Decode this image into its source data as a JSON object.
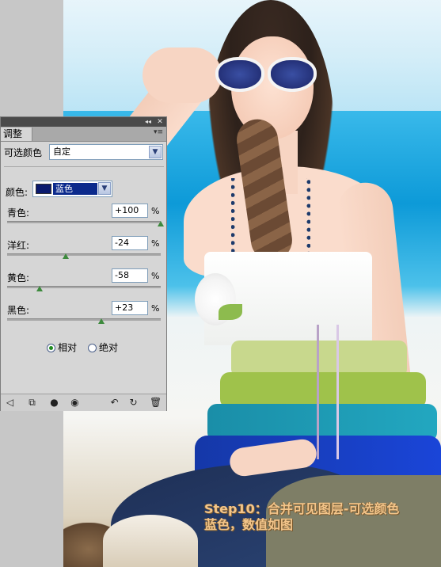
{
  "panel": {
    "tab_label": "调整",
    "collapse_icon": "double-chevron-icon",
    "close_icon": "close-icon",
    "menu_icon": "panel-menu-icon",
    "title": "可选颜色",
    "preset_value": "自定",
    "color_label": "颜色:",
    "color_value": "蓝色",
    "color_chip": "#0a1a6e",
    "sliders": [
      {
        "label": "青色:",
        "value": "+100",
        "unit": "%",
        "level": 100
      },
      {
        "label": "洋红:",
        "value": "-24",
        "unit": "%",
        "level": -24
      },
      {
        "label": "黄色:",
        "value": "-58",
        "unit": "%",
        "level": -58
      },
      {
        "label": "黑色:",
        "value": "+23",
        "unit": "%",
        "level": 23
      }
    ],
    "method_relative": "相对",
    "method_absolute": "绝对",
    "method_selected": "relative",
    "footer_icons": [
      "back-arrow-icon",
      "clip-layer-icon",
      "visibility-eye-toggle-icon",
      "eye-icon",
      "previous-state-icon",
      "reset-icon",
      "trash-icon"
    ]
  },
  "caption": {
    "line1": "Step10：合并可见图层-可选颜色",
    "line2": "蓝色，数值如图"
  },
  "colors": {
    "caption_text": "#f3c58a",
    "thumb": "#3d8a3d",
    "panel_bg": "#d6d6d6"
  }
}
